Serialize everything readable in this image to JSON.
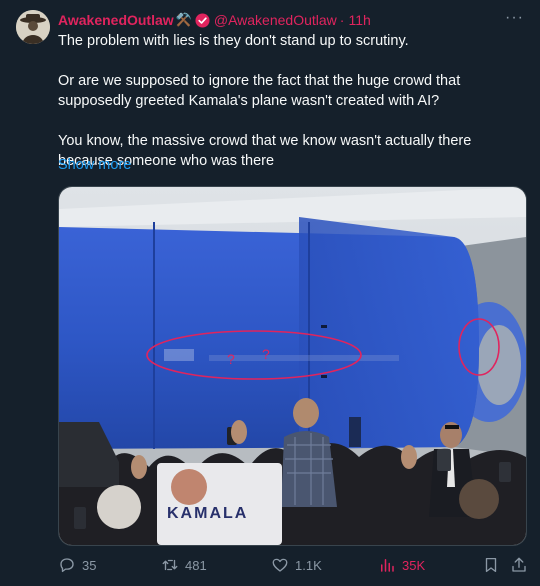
{
  "tweet": {
    "author_name": "AwakenedOutlaw",
    "author_emoji": "⚒️",
    "handle": "@AwakenedOutlaw",
    "separator": "·",
    "time": "11h",
    "more_label": "···",
    "paragraphs": [
      "The problem with lies is they don't stand up to scrutiny.",
      "Or are we supposed to ignore the fact that the huge crowd that supposedly greeted Kamala's plane wasn't created with AI?",
      "You know, the massive crowd that we know wasn't actually there because someone who was there"
    ],
    "show_more": "Show more",
    "media": {
      "sign_text": "KAMALA",
      "annotation_marks": [
        "?",
        "?"
      ]
    },
    "actions": {
      "replies": "35",
      "retweets": "481",
      "likes": "1.1K",
      "views": "35K"
    }
  },
  "colors": {
    "background": "#15202b",
    "name_color": "#e0245e",
    "link": "#1d9bf0",
    "muted": "#8b98a5",
    "annotation": "#e0245e",
    "engine_blue": "#2d55c8"
  }
}
